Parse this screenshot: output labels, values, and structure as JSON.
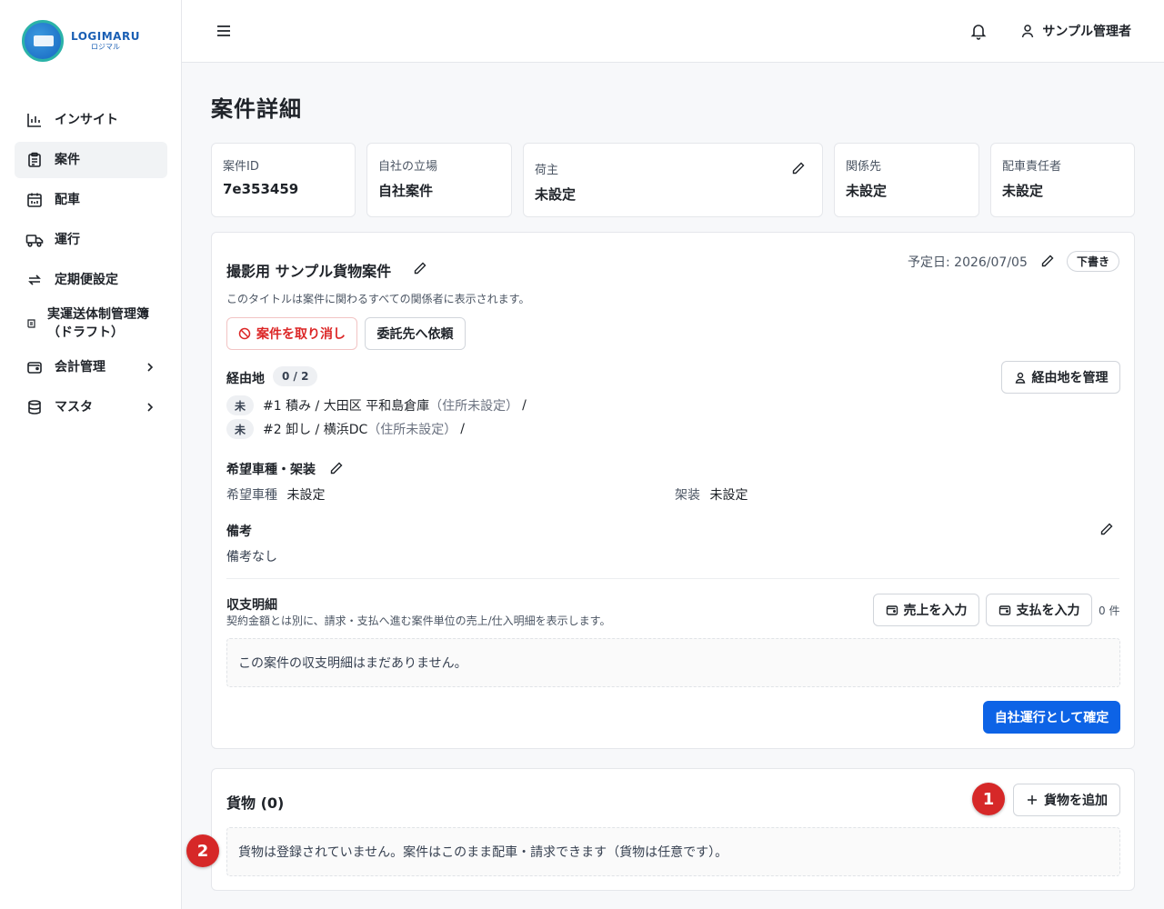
{
  "app": {
    "logo_en": "LOGIMARU",
    "logo_jp": "ロジマル"
  },
  "sidebar": {
    "items": [
      {
        "label": "インサイト",
        "icon": "bar-chart-icon"
      },
      {
        "label": "案件",
        "icon": "clipboard-icon",
        "active": true
      },
      {
        "label": "配車",
        "icon": "calendar-truck-icon"
      },
      {
        "label": "運行",
        "icon": "truck-icon"
      },
      {
        "label": "定期便設定",
        "icon": "repeat-icon"
      },
      {
        "label": "実運送体制管理簿（ドラフト）",
        "icon": "scroll-icon"
      },
      {
        "label": "会計管理",
        "icon": "wallet-icon",
        "has_children": true
      },
      {
        "label": "マスタ",
        "icon": "database-icon",
        "has_children": true
      }
    ]
  },
  "header": {
    "user_name": "サンプル管理者"
  },
  "page": {
    "title": "案件詳細"
  },
  "info_cards": [
    {
      "label": "案件ID",
      "value": "7e353459"
    },
    {
      "label": "自社の立場",
      "value": "自社案件"
    },
    {
      "label": "荷主",
      "value": "未設定"
    },
    {
      "label": "関係先",
      "value": "未設定"
    },
    {
      "label": "配車責任者",
      "value": "未設定"
    }
  ],
  "detail": {
    "title": "撮影用 サンプル貨物案件",
    "scheduled_date": "予定日: 2026/07/05",
    "status_badge": "下書き",
    "title_note": "このタイトルは案件に関わるすべての関係者に表示されます。",
    "cancel_button": "案件を取り消し",
    "delegate_button": "委託先へ依頼",
    "waypoints_label": "経由地",
    "waypoints_count": "0 / 2",
    "manage_waypoints_button": "経由地を管理",
    "stops": [
      {
        "status": "未",
        "text": "#1 積み / 大田区 平和島倉庫",
        "note": "（住所未設定）",
        "sep": "/"
      },
      {
        "status": "未",
        "text": "#2 卸し / 横浜DC",
        "note": "（住所未設定）",
        "sep": "/"
      }
    ],
    "vehicle_section": "希望車種・架装",
    "vehicle_type_label": "希望車種",
    "vehicle_type_value": "未設定",
    "body_label": "架装",
    "body_value": "未設定",
    "remarks_label": "備考",
    "remarks_value": "備考なし",
    "ledger_title": "収支明細",
    "ledger_note": "契約金額とは別に、請求・支払へ進む案件単位の売上/仕入明細を表示します。",
    "sales_button": "売上を入力",
    "payment_button": "支払を入力",
    "ledger_count": "0 件",
    "ledger_empty": "この案件の収支明細はまだありません。",
    "confirm_button": "自社運行として確定"
  },
  "cargo": {
    "title": "貨物 (0)",
    "add_button": "貨物を追加",
    "empty": "貨物は登録されていません。案件はこのまま配車・請求できます（貨物は任意です）。"
  },
  "markers": [
    "1",
    "2"
  ],
  "colors": {
    "primary": "#0d63e6",
    "danger": "#dc2626",
    "marker": "#d62828"
  }
}
